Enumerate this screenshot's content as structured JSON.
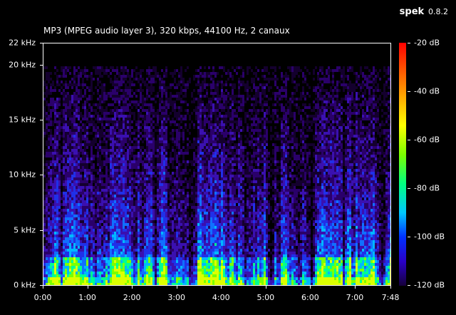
{
  "app": {
    "name": "spek",
    "version": "0.8.2"
  },
  "file_info": "MP3 (MPEG audio layer 3), 320 kbps, 44100 Hz, 2 canaux",
  "y_axis": {
    "labels": [
      "22 kHz",
      "20 kHz",
      "15 kHz",
      "10 kHz",
      "5 kHz",
      "0 kHz"
    ],
    "values": [
      22,
      20,
      15,
      10,
      5,
      0
    ],
    "max": 22
  },
  "x_axis": {
    "labels": [
      "0:00",
      "1:00",
      "2:00",
      "3:00",
      "4:00",
      "5:00",
      "6:00",
      "7:00",
      "7:48"
    ],
    "seconds": [
      0,
      60,
      120,
      180,
      240,
      300,
      360,
      420,
      468
    ],
    "duration": 468
  },
  "colorbar": {
    "labels": [
      "-20 dB",
      "-40 dB",
      "-60 dB",
      "-80 dB",
      "-100 dB",
      "-120 dB"
    ],
    "values": [
      -20,
      -40,
      -60,
      -80,
      -100,
      -120
    ]
  }
}
